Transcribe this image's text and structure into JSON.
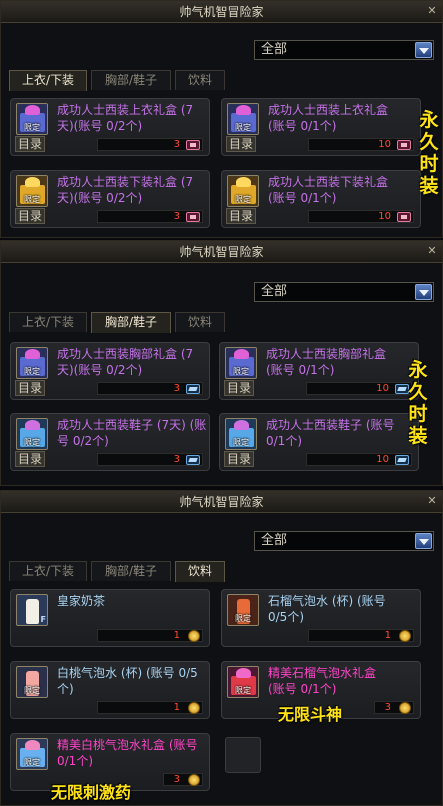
{
  "panels": [
    {
      "title": "帅气机智冒险家",
      "dropdown": "全部",
      "tabs": [
        "上衣/下装",
        "胸部/鞋子",
        "饮料"
      ],
      "active_tab": 0,
      "items": [
        {
          "name": "成功人士西装上衣礼盒 (7天)(账号 0/2个)",
          "tag": "限定",
          "button": "目录",
          "price": "3",
          "currency": "card-icon",
          "icon": "purple-gift-box-icon"
        },
        {
          "name": "成功人士西装上衣礼盒 (账号 0/1个)",
          "tag": "限定",
          "button": "目录",
          "price": "10",
          "currency": "card-icon",
          "icon": "purple-gift-box-icon"
        },
        {
          "name": "成功人士西装下装礼盒 (7天)(账号 0/2个)",
          "tag": "限定",
          "button": "目录",
          "price": "3",
          "currency": "card-icon",
          "icon": "gold-gift-box-icon"
        },
        {
          "name": "成功人士西装下装礼盒 (账号 0/1个)",
          "tag": "限定",
          "button": "目录",
          "price": "10",
          "currency": "card-icon",
          "icon": "gold-gift-box-icon"
        }
      ],
      "overlay": [
        "永",
        "久",
        "时",
        "装"
      ]
    },
    {
      "title": "帅气机智冒险家",
      "dropdown": "全部",
      "tabs": [
        "上衣/下装",
        "胸部/鞋子",
        "饮料"
      ],
      "active_tab": 1,
      "items": [
        {
          "name": "成功人士西装胸部礼盒 (7天)(账号 0/2个)",
          "tag": "限定",
          "button": "目录",
          "price": "3",
          "currency": "gem-icon",
          "icon": "purple-gift-box-icon"
        },
        {
          "name": "成功人士西装胸部礼盒 (账号 0/1个)",
          "tag": "限定",
          "button": "目录",
          "price": "10",
          "currency": "gem-icon",
          "icon": "purple-gift-box-icon"
        },
        {
          "name": "成功人士西装鞋子 (7天) (账号 0/2个)",
          "tag": "限定",
          "button": "目录",
          "price": "3",
          "currency": "gem-icon",
          "icon": "blue-gift-box-icon"
        },
        {
          "name": "成功人士西装鞋子 (账号 0/1个)",
          "tag": "限定",
          "button": "目录",
          "price": "10",
          "currency": "gem-icon",
          "icon": "blue-gift-box-icon"
        }
      ],
      "overlay": [
        "永",
        "久",
        "时",
        "装"
      ]
    },
    {
      "title": "帅气机智冒险家",
      "dropdown": "全部",
      "tabs": [
        "上衣/下装",
        "胸部/鞋子",
        "饮料"
      ],
      "active_tab": 2,
      "items": [
        {
          "name": "皇家奶茶",
          "tag": "",
          "button": "",
          "price": "1",
          "currency": "coin-icon",
          "icon": "milk-tea-bottle-icon",
          "mark": "F"
        },
        {
          "name": "石榴气泡水 (杯) (账号 0/5个)",
          "tag": "限定",
          "button": "",
          "price": "1",
          "currency": "coin-icon",
          "icon": "pomegranate-soda-icon"
        },
        {
          "name": "白桃气泡水 (杯) (账号 0/5个)",
          "tag": "限定",
          "button": "",
          "price": "1",
          "currency": "coin-icon",
          "icon": "peach-soda-icon"
        },
        {
          "name": "精美石榴气泡水礼盒 (账号 0/1个)",
          "tag": "限定",
          "button": "",
          "price": "3",
          "currency": "coin-icon",
          "icon": "pomegranate-gift-box-icon"
        },
        {
          "name": "精美白桃气泡水礼盒 (账号 0/1个)",
          "tag": "限定",
          "button": "",
          "price": "3",
          "currency": "coin-icon",
          "icon": "peach-gift-box-icon"
        }
      ],
      "overlay_a": "无限斗神",
      "overlay_b": "无限刺激药"
    }
  ],
  "colors": {
    "accent_yellow": "#ffe316",
    "item_purple": "#c572e8",
    "item_blue": "#a8d2f0",
    "item_pink": "#ff44c8",
    "price_red": "#ff4a2e"
  }
}
